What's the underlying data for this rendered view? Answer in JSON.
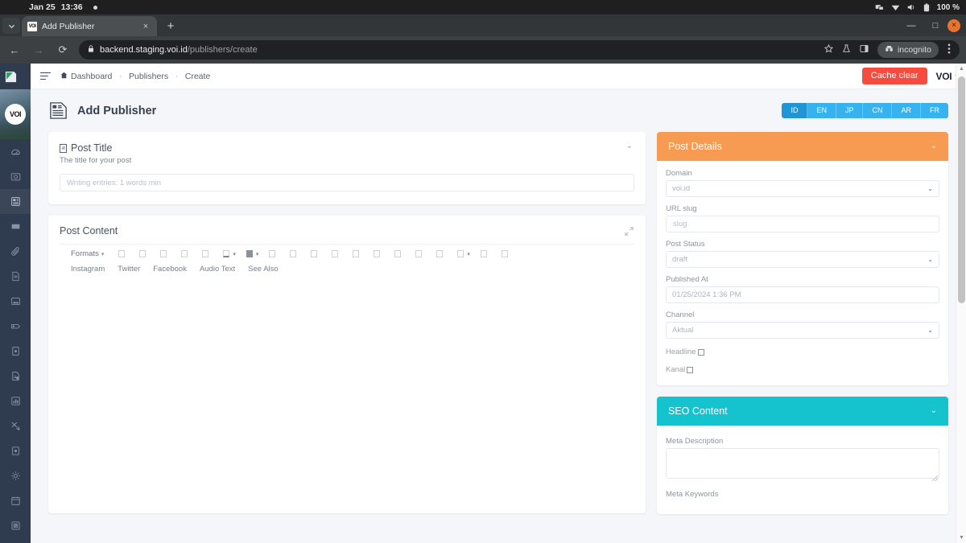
{
  "os": {
    "date": "Jan 25",
    "time": "13:36",
    "battery": "100 %",
    "icons": [
      "display-icon",
      "wifi-icon",
      "volume-icon",
      "battery-icon"
    ]
  },
  "browser": {
    "tab": {
      "title": "Add Publisher",
      "favicon_text": "VOI"
    },
    "new_tab_label": "+",
    "close_label": "×",
    "window": {
      "minimize": "—",
      "maximize": "□",
      "close": "×"
    },
    "url": {
      "host": "backend.staging.voi.id",
      "path": "/publishers/create"
    },
    "profile_pill": "incognito",
    "nav": {
      "back": "←",
      "forward": "→",
      "reload": "⟳"
    }
  },
  "rail": {
    "brand_initials": "VOI",
    "items": [
      {
        "name": "sidebar-item-dashboard",
        "icon": "speedometer-icon"
      },
      {
        "name": "sidebar-item-media",
        "icon": "camera-icon"
      },
      {
        "name": "sidebar-item-publishers",
        "icon": "news-icon",
        "active": true
      },
      {
        "name": "sidebar-item-video",
        "icon": "video-icon"
      },
      {
        "name": "sidebar-item-tags",
        "icon": "paperclip-icon"
      },
      {
        "name": "sidebar-item-pages",
        "icon": "file-icon"
      },
      {
        "name": "sidebar-item-gallery",
        "icon": "image-icon"
      },
      {
        "name": "sidebar-item-labels",
        "icon": "tag-icon"
      },
      {
        "name": "sidebar-item-documents",
        "icon": "doc-icon"
      },
      {
        "name": "sidebar-item-reports",
        "icon": "doc-check-icon"
      },
      {
        "name": "sidebar-item-analytics",
        "icon": "chart-icon"
      },
      {
        "name": "sidebar-item-tools",
        "icon": "tools-icon"
      },
      {
        "name": "sidebar-item-archive",
        "icon": "box-icon"
      },
      {
        "name": "sidebar-item-settings",
        "icon": "gear-icon"
      },
      {
        "name": "sidebar-item-calendar",
        "icon": "calendar-icon"
      },
      {
        "name": "sidebar-item-modules",
        "icon": "grid-icon"
      }
    ]
  },
  "topbar": {
    "breadcrumb": [
      {
        "label": "Dashboard",
        "home": true
      },
      {
        "label": "Publishers"
      },
      {
        "label": "Create"
      }
    ],
    "separator": "›",
    "cache_clear_label": "Cache clear",
    "brand": "VOI",
    "brand_caret": "▾"
  },
  "page": {
    "title": "Add Publisher",
    "title_icon": "article-icon",
    "languages": [
      {
        "code": "ID",
        "active": true
      },
      {
        "code": "EN",
        "active": false
      },
      {
        "code": "JP",
        "active": false
      },
      {
        "code": "CN",
        "active": false
      },
      {
        "code": "AR",
        "active": false
      },
      {
        "code": "FR",
        "active": false
      }
    ]
  },
  "post_title_card": {
    "title": "Post Title",
    "subtitle": "The title for your post",
    "collapse_caret": "⌄",
    "input_placeholder": "Writing entries: 1 words min",
    "input_value": ""
  },
  "post_content_card": {
    "title": "Post Content",
    "expand_icon": "expand-icon",
    "toolbar": {
      "formats_label": "Formats",
      "formats_caret": "▾",
      "buttons": [
        {
          "name": "bold-button",
          "style": "box"
        },
        {
          "name": "italic-button",
          "style": "box"
        },
        {
          "name": "underline-button",
          "style": "box"
        },
        {
          "name": "strikethrough-button",
          "style": "box"
        },
        {
          "name": "clear-format-button",
          "style": "box"
        },
        {
          "name": "text-color-button",
          "style": "underlined",
          "dropdown": true
        },
        {
          "name": "background-color-button",
          "style": "filled",
          "dropdown": true
        },
        {
          "name": "align-left-button",
          "style": "box"
        },
        {
          "name": "align-center-button",
          "style": "box"
        },
        {
          "name": "align-right-button",
          "style": "box"
        },
        {
          "name": "align-justify-button",
          "style": "box"
        },
        {
          "name": "bullet-list-button",
          "style": "box"
        },
        {
          "name": "numbered-list-button",
          "style": "box"
        },
        {
          "name": "outdent-button",
          "style": "box"
        },
        {
          "name": "indent-button",
          "style": "box"
        },
        {
          "name": "blockquote-button",
          "style": "box"
        },
        {
          "name": "table-button",
          "style": "box",
          "dropdown": true
        },
        {
          "name": "link-button",
          "style": "box"
        },
        {
          "name": "image-button",
          "style": "box"
        }
      ],
      "plugins": [
        "Instagram",
        "Twitter",
        "Facebook",
        "Audio Text",
        "See Also"
      ]
    }
  },
  "post_details": {
    "heading": "Post Details",
    "collapse_caret": "⌄",
    "fields": [
      {
        "label": "Domain",
        "type": "select",
        "value": "voi.id"
      },
      {
        "label": "URL slug",
        "type": "text",
        "value": "",
        "placeholder": "slug"
      },
      {
        "label": "Post Status",
        "type": "select",
        "value": "draft"
      },
      {
        "label": "Published At",
        "type": "text",
        "value": "01/25/2024 1:36 PM"
      },
      {
        "label": "Channel",
        "type": "select",
        "value": "Aktual"
      }
    ],
    "checkboxes": [
      {
        "label": "Headline",
        "checked": false
      },
      {
        "label": "Kanal",
        "checked": false
      }
    ],
    "select_arrow": "⌄"
  },
  "seo_content": {
    "heading": "SEO Content",
    "collapse_caret": "⌄",
    "fields": [
      {
        "label": "Meta Description",
        "type": "textarea",
        "value": ""
      },
      {
        "label": "Meta Keywords",
        "type": "textarea",
        "value": ""
      }
    ]
  },
  "colors": {
    "accent_red": "#f84b3f",
    "lang_tab": "#35b2ef",
    "lang_tab_active": "#2196d6",
    "panel_orange": "#f79a52",
    "panel_teal": "#14c3cd",
    "rail": "#2f3c4f"
  }
}
